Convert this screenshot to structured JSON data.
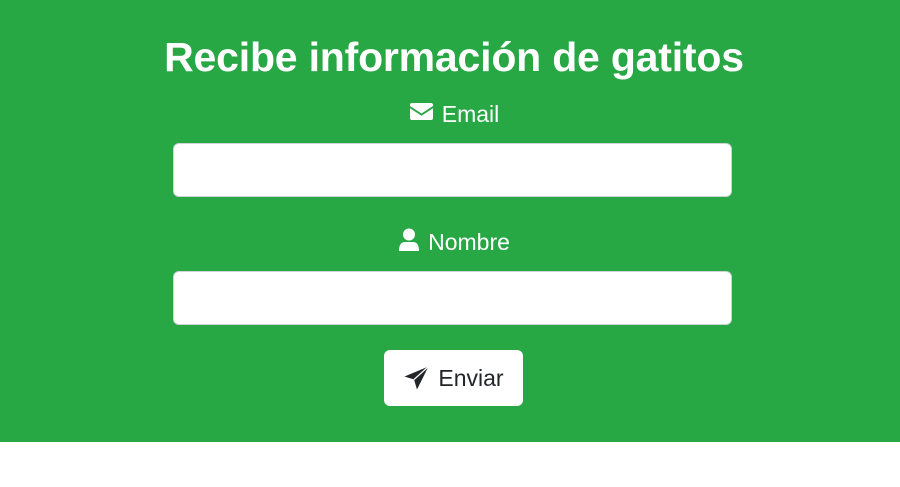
{
  "form": {
    "title": "Recibe información de gatitos",
    "email_label": "Email",
    "email_value": "",
    "name_label": "Nombre",
    "name_value": "",
    "submit_label": "Enviar"
  },
  "icons": {
    "email": "envelope-icon",
    "name": "user-icon",
    "submit": "paper-plane-icon"
  },
  "colors": {
    "panel_background": "#28a745",
    "text_on_panel": "#ffffff",
    "button_background": "#ffffff",
    "button_text": "#212529"
  }
}
